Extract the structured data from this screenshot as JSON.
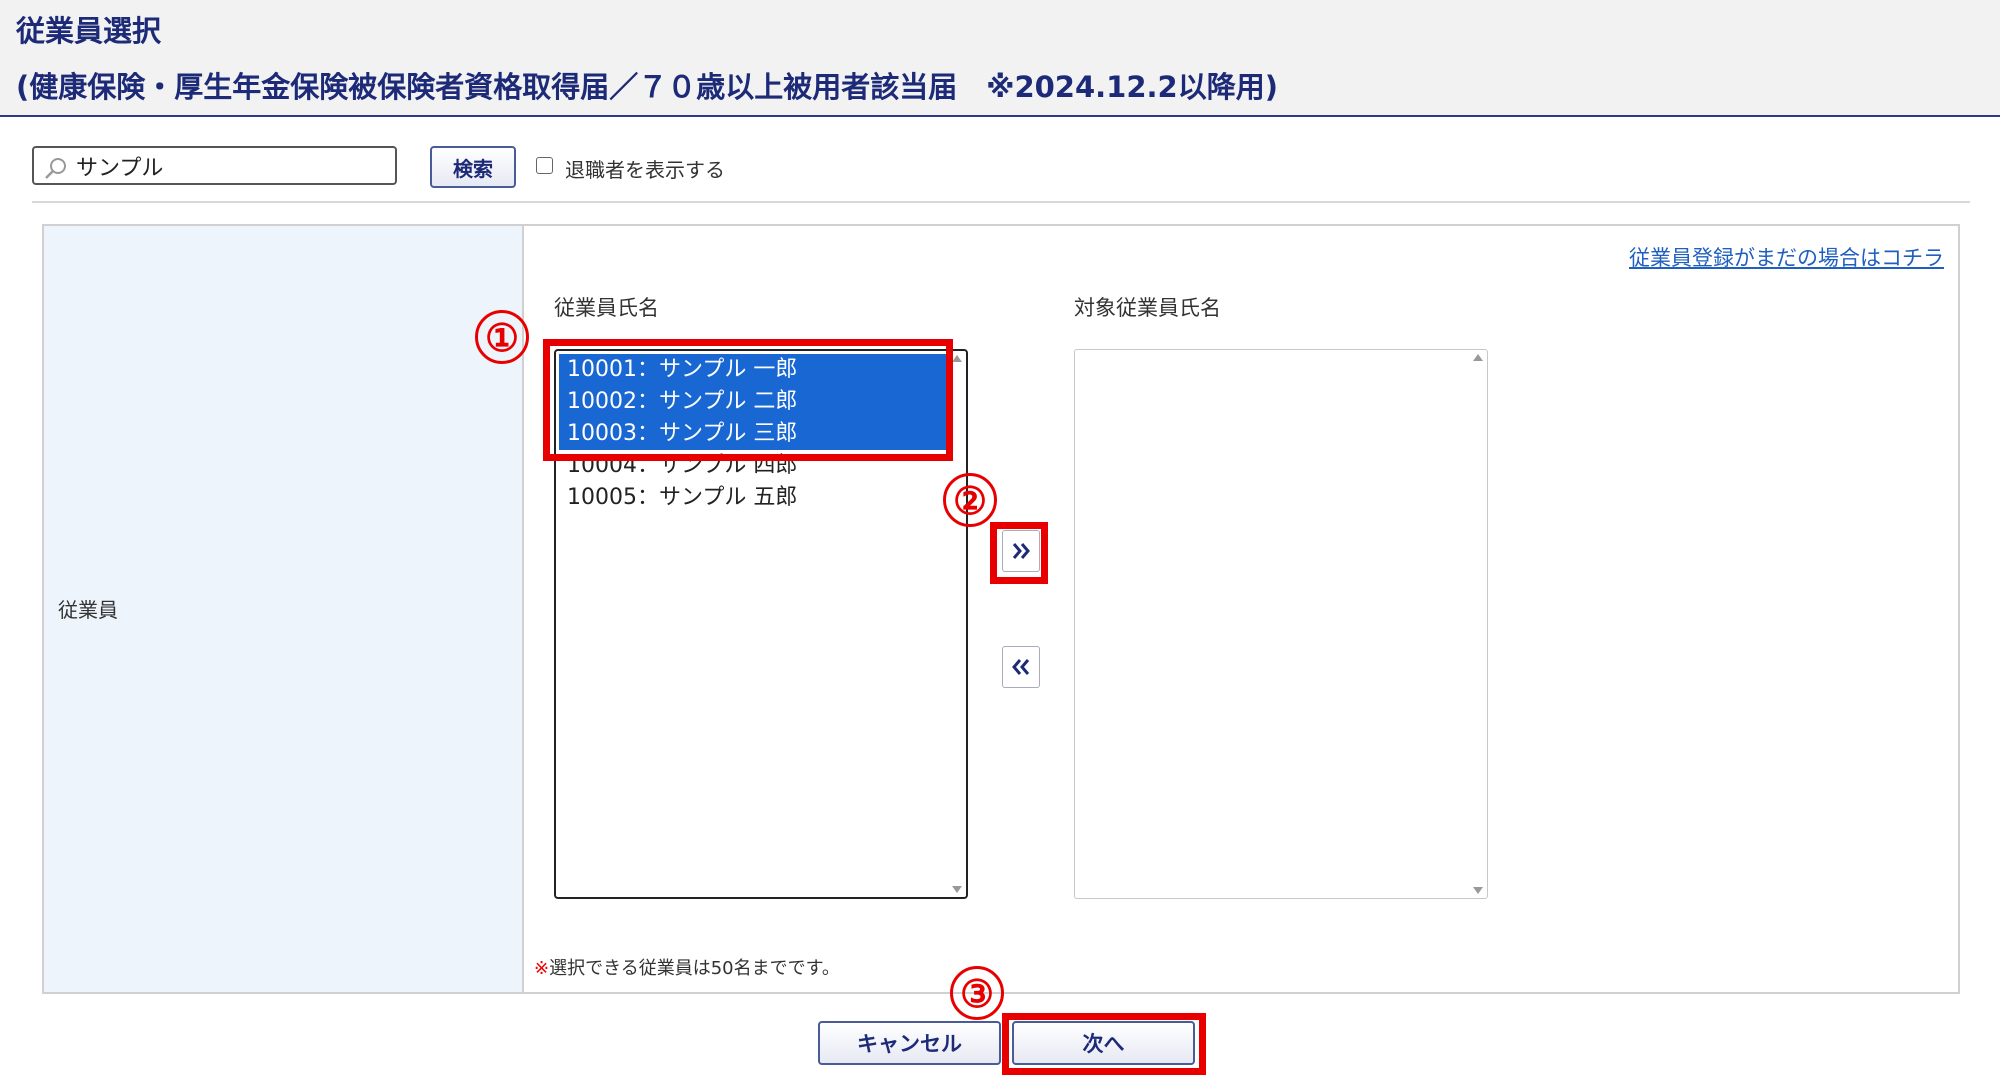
{
  "header": {
    "title": "従業員選択",
    "subtitle": "(健康保険・厚生年金保険被保険者資格取得届／７０歳以上被用者該当届　※2024.12.2以降用)"
  },
  "search": {
    "value": "サンプル",
    "button_label": "検索",
    "retired_label": "退職者を表示する"
  },
  "form": {
    "row_label": "従業員",
    "register_link": "従業員登録がまだの場合はコチラ",
    "left_list_label": "従業員氏名",
    "right_list_label": "対象従業員氏名",
    "employees": [
      {
        "text": "10001：サンプル 一郎"
      },
      {
        "text": "10002：サンプル 二郎"
      },
      {
        "text": "10003：サンプル 三郎"
      },
      {
        "text": "10004：サンプル 四郎"
      },
      {
        "text": "10005：サンプル 五郎"
      }
    ],
    "add_button": "»",
    "remove_button": "«",
    "note_mark": "※",
    "note_text": "選択できる従業員は50名までです。"
  },
  "footer": {
    "cancel_label": "キャンセル",
    "next_label": "次へ"
  },
  "annotations": [
    "①",
    "②",
    "③"
  ],
  "colors": {
    "accent": "#1c2a78",
    "selection": "#1967d2",
    "annotation": "#e80000",
    "label_bg": "#eef4fb"
  }
}
